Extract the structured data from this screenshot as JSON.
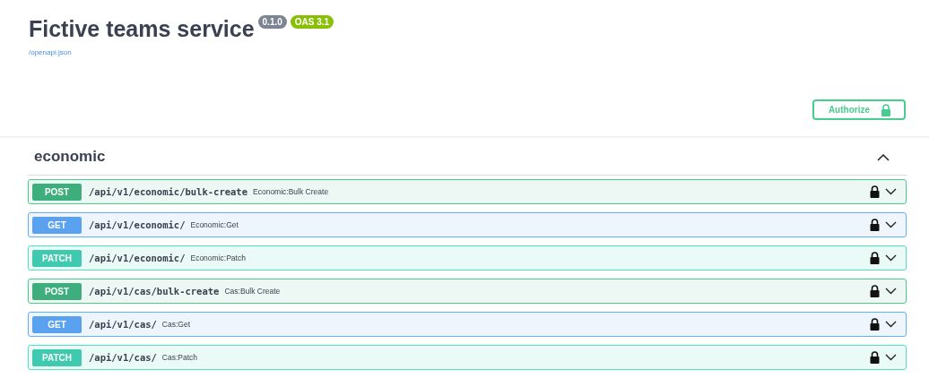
{
  "info": {
    "title": "Fictive teams service",
    "version": "0.1.0",
    "oas": "OAS 3.1",
    "spec_link": "/openapi.json"
  },
  "authorize": {
    "label": "Authorize"
  },
  "sections": [
    {
      "name": "economic",
      "expanded": true,
      "operations": [
        {
          "kind": "post",
          "method": "POST",
          "path": "/api/v1/economic/bulk-create",
          "summary": "Economic:Bulk Create",
          "expanded": false
        },
        {
          "kind": "get",
          "method": "GET",
          "path": "/api/v1/economic/",
          "summary": "Economic:Get",
          "expanded": false
        },
        {
          "kind": "patch",
          "method": "PATCH",
          "path": "/api/v1/economic/",
          "summary": "Economic:Patch",
          "expanded": false
        },
        {
          "kind": "post",
          "method": "POST",
          "path": "/api/v1/cas/bulk-create",
          "summary": "Cas:Bulk Create",
          "expanded": false
        },
        {
          "kind": "get",
          "method": "GET",
          "path": "/api/v1/cas/",
          "summary": "Cas:Get",
          "expanded": false
        },
        {
          "kind": "patch",
          "method": "PATCH",
          "path": "/api/v1/cas/",
          "summary": "Cas:Patch",
          "expanded": false
        }
      ]
    }
  ]
}
